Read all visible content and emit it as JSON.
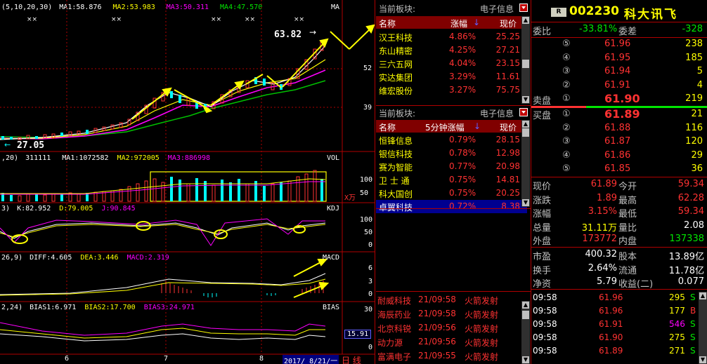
{
  "chart": {
    "ma_label": "(5,10,20,30)",
    "ma1": "MA1:58.876",
    "ma2": "MA2:53.983",
    "ma3": "MA3:50.311",
    "ma4": "MA4:47.570",
    "corner": "MA",
    "high_label": "63.82",
    "low_label": "27.05",
    "axis_52": "52",
    "axis_39": "39",
    "vol_prefix": ",20)",
    "vol_val": "311111",
    "vol_ma1": "MA1:1072582",
    "vol_ma2": "MA2:972005",
    "vol_ma3": "MA3:886998",
    "vol_corner": "VOL",
    "vol_100": "100",
    "vol_50": "50",
    "vol_unit": "X万",
    "kdj_prefix": "3)",
    "kdj_k": "K:82.952",
    "kdj_d": "D:79.005",
    "kdj_j": "J:90.845",
    "kdj_corner": "KDJ",
    "kdj_100": "100",
    "kdj_50": "50",
    "kdj_0": "0",
    "macd_prefix": "26,9)",
    "macd_diff": "DIFF:4.605",
    "macd_dea": "DEA:3.446",
    "macd_val": "MACD:2.319",
    "macd_corner": "MACD",
    "macd_6": "6",
    "macd_3": "3",
    "macd_0": "0",
    "bias_prefix": "2,24)",
    "bias1": "BIAS1:6.971",
    "bias2": "BIAS2:17.700",
    "bias3": "BIAS3:24.971",
    "bias_corner": "BIAS",
    "bias_30": "30",
    "bias_15": "15.91",
    "bias_0": "0",
    "x_6": "6",
    "x_7": "7",
    "x_8": "8",
    "date_box": "2017/ 8/21/一",
    "period": "日 线"
  },
  "sector1": {
    "title": "当前板块:",
    "name": "电子信息",
    "cols": [
      "名称",
      "涨幅",
      "现价"
    ],
    "rows": [
      {
        "name": "汉王科技",
        "pct": "4.86%",
        "price": "25.25"
      },
      {
        "name": "东山精密",
        "pct": "4.25%",
        "price": "27.21"
      },
      {
        "name": "三六五网",
        "pct": "4.04%",
        "price": "23.15"
      },
      {
        "name": "实达集团",
        "pct": "3.29%",
        "price": "11.61"
      },
      {
        "name": "维宏股份",
        "pct": "3.27%",
        "price": "75.75"
      }
    ]
  },
  "sector2": {
    "title": "当前板块:",
    "name": "电子信息",
    "cols": [
      "名称",
      "5分钟涨幅",
      "现价"
    ],
    "rows": [
      {
        "name": "恒锋信息",
        "pct": "0.79%",
        "price": "28.15"
      },
      {
        "name": "银信科技",
        "pct": "0.78%",
        "price": "12.98"
      },
      {
        "name": "赛为智能",
        "pct": "0.77%",
        "price": "20.98"
      },
      {
        "name": "卫 士 通",
        "pct": "0.75%",
        "price": "14.81"
      },
      {
        "name": "科大国创",
        "pct": "0.75%",
        "price": "20.25"
      },
      {
        "name": "卓翼科技",
        "pct": "0.72%",
        "price": "8.38"
      }
    ]
  },
  "alerts": [
    {
      "name": "耐威科技",
      "time": "21/09:58",
      "msg": "火箭发射"
    },
    {
      "name": "海辰药业",
      "time": "21/09:58",
      "msg": "火箭发射"
    },
    {
      "name": "北京科锐",
      "time": "21/09:56",
      "msg": "火箭发射"
    },
    {
      "name": "动力源",
      "time": "21/09:56",
      "msg": "火箭发射"
    },
    {
      "name": "富满电子",
      "time": "21/09:55",
      "msg": "火箭发射"
    }
  ],
  "quote": {
    "badge": "R",
    "code": "002230",
    "name": "科大讯飞",
    "weibi_label": "委比",
    "weibi": "-33.81%",
    "weicha_label": "委差",
    "weicha": "-328",
    "sell_label": "卖盘",
    "buy_label": "买盘",
    "sells": [
      {
        "lvl": "⑤",
        "price": "61.96",
        "vol": "238"
      },
      {
        "lvl": "④",
        "price": "61.95",
        "vol": "185"
      },
      {
        "lvl": "③",
        "price": "61.94",
        "vol": "5"
      },
      {
        "lvl": "②",
        "price": "61.91",
        "vol": "4"
      },
      {
        "lvl": "①",
        "price": "61.90",
        "vol": "219"
      }
    ],
    "buys": [
      {
        "lvl": "①",
        "price": "61.89",
        "vol": "21"
      },
      {
        "lvl": "②",
        "price": "61.88",
        "vol": "116"
      },
      {
        "lvl": "③",
        "price": "61.87",
        "vol": "120"
      },
      {
        "lvl": "④",
        "price": "61.86",
        "vol": "29"
      },
      {
        "lvl": "⑤",
        "price": "61.85",
        "vol": "36"
      }
    ],
    "info": [
      {
        "l1": "现价",
        "v1": "61.89",
        "c1": "red",
        "l2": "今开",
        "v2": "59.34",
        "c2": "red"
      },
      {
        "l1": "涨跌",
        "v1": "1.89",
        "c1": "red",
        "l2": "最高",
        "v2": "62.28",
        "c2": "red"
      },
      {
        "l1": "涨幅",
        "v1": "3.15%",
        "c1": "red",
        "l2": "最低",
        "v2": "59.34",
        "c2": "red"
      },
      {
        "l1": "总量",
        "v1": "31.11万",
        "c1": "yel",
        "l2": "量比",
        "v2": "2.08",
        "c2": "wht"
      },
      {
        "l1": "外盘",
        "v1": "173772",
        "c1": "red",
        "l2": "内盘",
        "v2": "137338",
        "c2": "grn"
      },
      {
        "l1": "市盈",
        "v1": "400.32",
        "c1": "wht",
        "l2": "股本",
        "v2": "13.89亿",
        "c2": "wht"
      },
      {
        "l1": "换手",
        "v1": "2.64%",
        "c1": "wht",
        "l2": "流通",
        "v2": "11.78亿",
        "c2": "wht"
      },
      {
        "l1": "净资",
        "v1": "5.79",
        "c1": "wht",
        "l2": "收益(二)",
        "v2": "0.077",
        "c2": "wht"
      }
    ],
    "ticks": [
      {
        "time": "09:58",
        "price": "61.96",
        "vol": "295",
        "side": "S",
        "vc": "yel",
        "sc": "grn"
      },
      {
        "time": "09:58",
        "price": "61.96",
        "vol": "177",
        "side": "B",
        "vc": "yel",
        "sc": "red"
      },
      {
        "time": "09:58",
        "price": "61.91",
        "vol": "546",
        "side": "S",
        "vc": "mag",
        "sc": "grn"
      },
      {
        "time": "09:58",
        "price": "61.90",
        "vol": "275",
        "side": "S",
        "vc": "yel",
        "sc": "grn"
      },
      {
        "time": "09:58",
        "price": "61.89",
        "vol": "271",
        "side": "S",
        "vc": "yel",
        "sc": "grn"
      }
    ]
  }
}
